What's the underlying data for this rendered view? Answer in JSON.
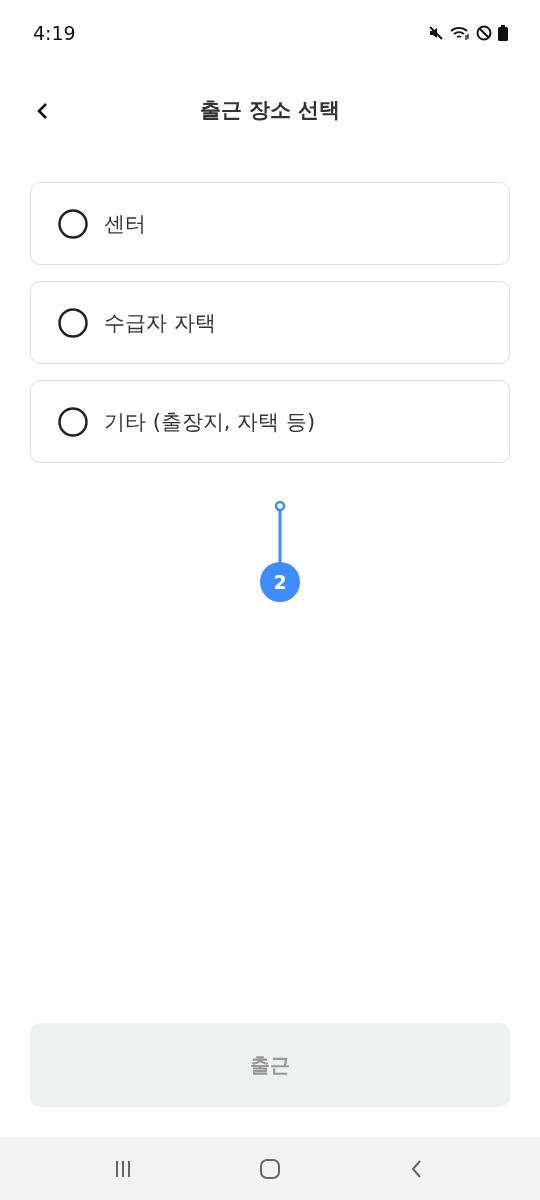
{
  "status_bar": {
    "time": "4:19"
  },
  "header": {
    "title": "출근 장소 선택"
  },
  "options": [
    {
      "label": "센터",
      "selected": false
    },
    {
      "label": "수급자 자택",
      "selected": false
    },
    {
      "label": "기타 (출장지, 자택 등)",
      "selected": false
    }
  ],
  "marker": {
    "label": "2"
  },
  "submit": {
    "label": "출근",
    "disabled": true
  }
}
